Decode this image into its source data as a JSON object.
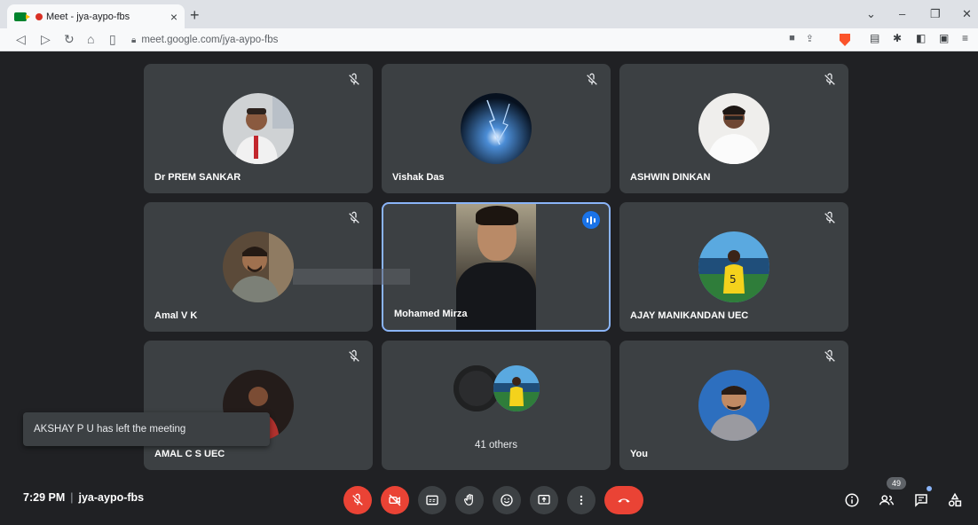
{
  "browser": {
    "tab_title": "Meet - jya-aypo-fbs",
    "url": "meet.google.com/jya-aypo-fbs"
  },
  "tiles": [
    {
      "name": "Dr PREM SANKAR"
    },
    {
      "name": "Vishak Das"
    },
    {
      "name": "ASHWIN DINKAN"
    },
    {
      "name": "Amal V K"
    },
    {
      "name": "Mohamed Mirza"
    },
    {
      "name": "AJAY MANIKANDAN UEC"
    },
    {
      "name": "AMAL C S UEC"
    },
    {
      "name": "41 others"
    },
    {
      "name": "You"
    }
  ],
  "toast": "AKSHAY P U has left the meeting",
  "footer": {
    "time": "7:29 PM",
    "meeting_code": "jya-aypo-fbs",
    "people_count": "49"
  },
  "colors": {
    "background": "#202124",
    "tile": "#3c4043",
    "danger": "#ea4335",
    "active_border": "#8ab4f8",
    "speaking": "#1a73e8"
  }
}
